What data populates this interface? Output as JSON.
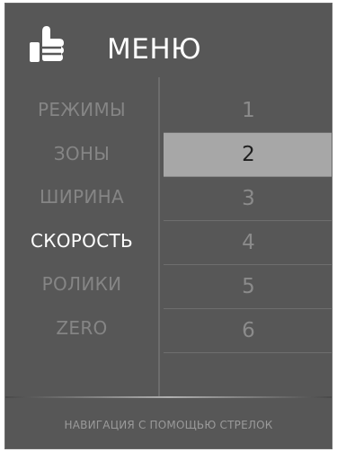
{
  "header": {
    "title": "МЕНЮ",
    "icon": "thumbs-up-icon"
  },
  "menu": {
    "items": [
      {
        "label": "РЕЖИМЫ",
        "active": false
      },
      {
        "label": "ЗОНЫ",
        "active": false
      },
      {
        "label": "ШИРИНА",
        "active": false
      },
      {
        "label": "СКОРОСТЬ",
        "active": true
      },
      {
        "label": "РОЛИКИ",
        "active": false
      },
      {
        "label": "ZERO",
        "active": false
      }
    ]
  },
  "values": {
    "items": [
      "1",
      "2",
      "3",
      "4",
      "5",
      "6",
      ""
    ],
    "selected_value": "2"
  },
  "footer": {
    "hint": "НАВИГАЦИЯ С ПОМОЩЬЮ СТРЕЛОК"
  },
  "colors": {
    "background": "#575757",
    "selected": "#a7a7a7",
    "active_text": "#ffffff",
    "inactive_text": "#858585"
  }
}
